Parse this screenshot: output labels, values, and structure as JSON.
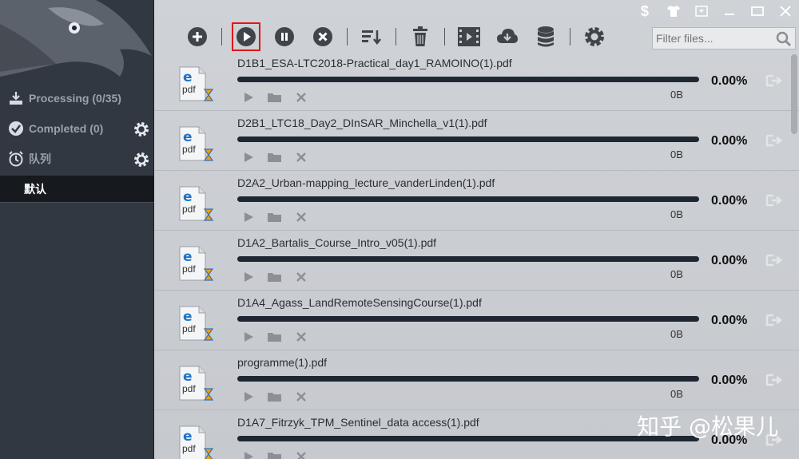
{
  "sidebar": {
    "categories": [
      {
        "label": "Processing (0/35)",
        "icon": "download-tray-icon"
      },
      {
        "label": "Completed (0)",
        "icon": "check-circle-icon"
      },
      {
        "label": "队列",
        "icon": "alarm-clock-icon"
      }
    ],
    "queue_selected": "默认"
  },
  "toolbar": {
    "buttons": [
      "add-icon",
      "start-icon",
      "pause-icon",
      "stop-icon",
      "sort-icon",
      "delete-icon",
      "video-icon",
      "cloud-download-icon",
      "database-icon",
      "settings-icon"
    ],
    "selected": "start-icon",
    "filter_placeholder": "Filter files..."
  },
  "downloads": [
    {
      "name": "D1B1_ESA-LTC2018-Practical_day1_RAMOINO(1).pdf",
      "progress": "0.00%",
      "size": "0B"
    },
    {
      "name": "D2B1_LTC18_Day2_DInSAR_Minchella_v1(1).pdf",
      "progress": "0.00%",
      "size": "0B"
    },
    {
      "name": "D2A2_Urban-mapping_lecture_vanderLinden(1).pdf",
      "progress": "0.00%",
      "size": "0B"
    },
    {
      "name": "D1A2_Bartalis_Course_Intro_v05(1).pdf",
      "progress": "0.00%",
      "size": "0B"
    },
    {
      "name": "D1A4_Agass_LandRemoteSensingCourse(1).pdf",
      "progress": "0.00%",
      "size": "0B"
    },
    {
      "name": "programme(1).pdf",
      "progress": "0.00%",
      "size": "0B"
    },
    {
      "name": "D1A7_Fitrzyk_TPM_Sentinel_data access(1).pdf",
      "progress": "0.00%",
      "size": ""
    }
  ],
  "watermark": "知乎 @松果儿",
  "colors": {
    "sidebar_bg": "#323841",
    "progress_bar": "#1f2733",
    "selected_outline": "#e0161b"
  }
}
